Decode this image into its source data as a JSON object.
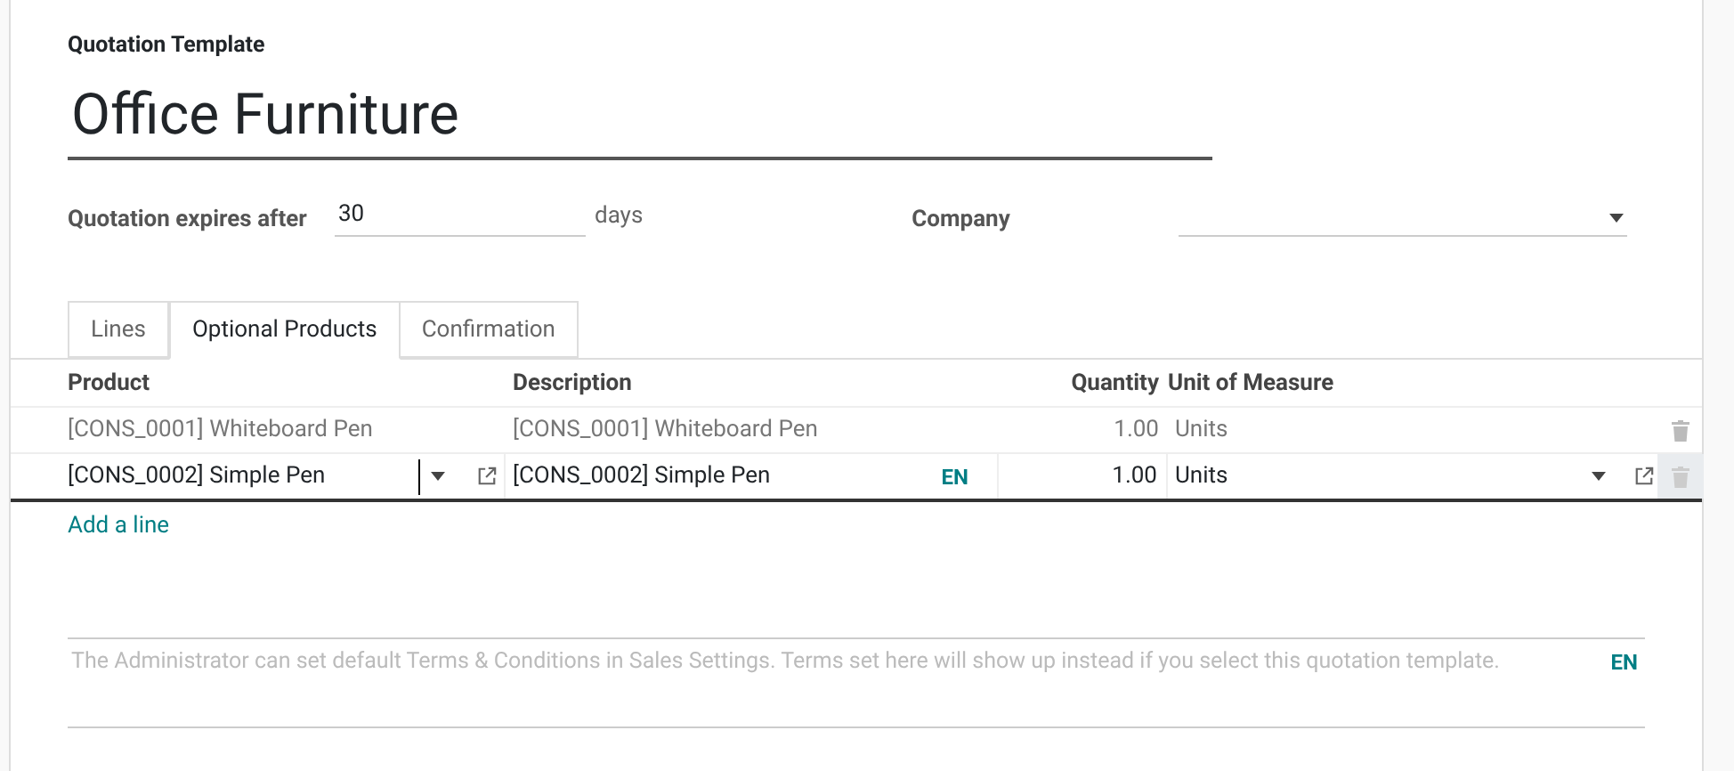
{
  "form_label": "Quotation Template",
  "name": "Office Furniture",
  "expires": {
    "label": "Quotation expires after",
    "value": "30",
    "unit": "days"
  },
  "company": {
    "label": "Company"
  },
  "tabs": [
    {
      "label": "Lines",
      "selected": false
    },
    {
      "label": "Optional Products",
      "selected": true
    },
    {
      "label": "Confirmation",
      "selected": false
    }
  ],
  "table": {
    "columns": [
      "Product",
      "Description",
      "Quantity",
      "Unit of Measure"
    ],
    "rows": [
      {
        "product": "[CONS_0001] Whiteboard Pen",
        "description": "[CONS_0001] Whiteboard Pen",
        "quantity": "1.00",
        "uom": "Units",
        "editing": false
      },
      {
        "product": "[CONS_0002] Simple Pen",
        "description": "[CONS_0002] Simple Pen",
        "lang": "EN",
        "quantity": "1.00",
        "uom": "Units",
        "editing": true
      }
    ],
    "add_line": "Add a line"
  },
  "terms": {
    "placeholder": "The Administrator can set default Terms & Conditions in Sales Settings. Terms set here will show up instead if you select this quotation template.",
    "lang": "EN"
  }
}
